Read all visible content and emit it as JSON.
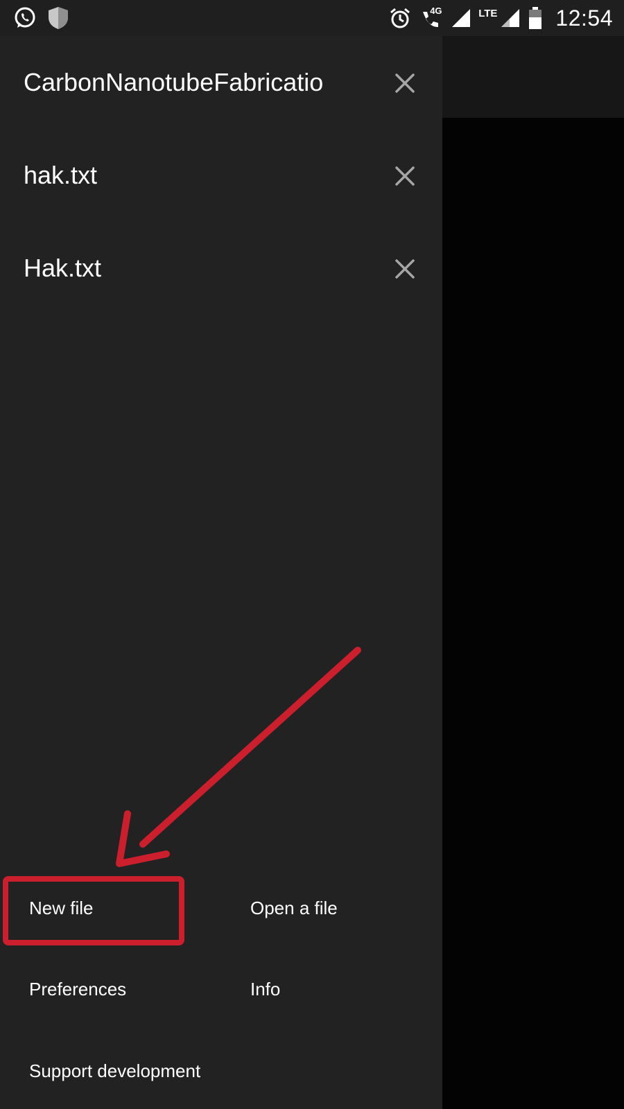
{
  "status_bar": {
    "left_icons": [
      "whatsapp-icon",
      "shield-icon"
    ],
    "right_icons": [
      "alarm-icon",
      "volte-call-icon",
      "signal-icon",
      "lte-signal-icon",
      "battery-icon"
    ],
    "volte_label": "4G",
    "network_label": "LTE",
    "time": "12:54"
  },
  "drawer": {
    "open_files": [
      {
        "name": "CarbonNanotubeFabricatio"
      },
      {
        "name": "hak.txt"
      },
      {
        "name": "Hak.txt"
      }
    ],
    "menu": {
      "new_file": "New file",
      "open_file": "Open a file",
      "preferences": "Preferences",
      "info": "Info",
      "support": "Support development"
    }
  },
  "annotation": {
    "color": "#cc1f2e",
    "target": "new-file-menu-item"
  },
  "colors": {
    "drawer_bg": "#222223",
    "status_bar_bg": "#1f1f1f",
    "app_toolbar_bg": "#171717",
    "app_content_bg": "#030303",
    "close_icon": "#a6a6a6"
  }
}
